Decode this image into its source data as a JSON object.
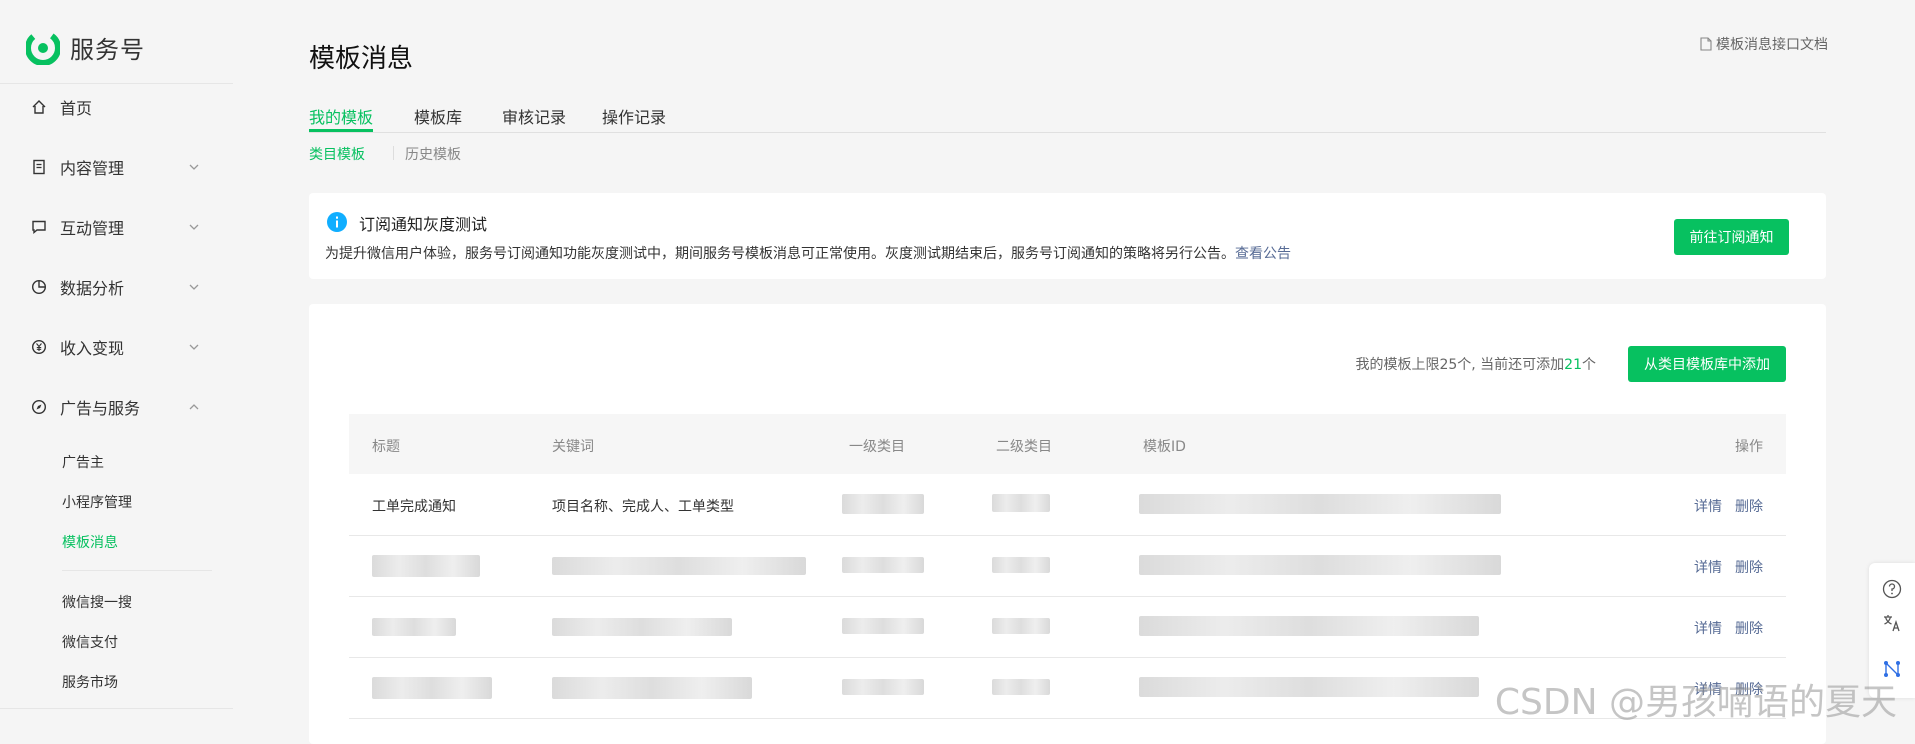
{
  "app": {
    "name": "服务号"
  },
  "sidebar": {
    "items": [
      {
        "label": "首页",
        "icon": "home-icon"
      },
      {
        "label": "内容管理",
        "icon": "document-icon",
        "expanded": false
      },
      {
        "label": "互动管理",
        "icon": "chat-icon",
        "expanded": false
      },
      {
        "label": "数据分析",
        "icon": "pie-chart-icon",
        "expanded": false
      },
      {
        "label": "收入变现",
        "icon": "yen-coin-icon",
        "expanded": false
      },
      {
        "label": "广告与服务",
        "icon": "compass-icon",
        "expanded": true
      }
    ],
    "sub_items": [
      {
        "label": "广告主",
        "active": false
      },
      {
        "label": "小程序管理",
        "active": false
      },
      {
        "label": "模板消息",
        "active": true
      },
      {
        "label": "微信搜一搜",
        "active": false
      },
      {
        "label": "微信支付",
        "active": false
      },
      {
        "label": "服务市场",
        "active": false
      }
    ]
  },
  "page": {
    "title": "模板消息",
    "doc_link": "模板消息接口文档",
    "tabs": [
      {
        "label": "我的模板",
        "active": true
      },
      {
        "label": "模板库",
        "active": false
      },
      {
        "label": "审核记录",
        "active": false
      },
      {
        "label": "操作记录",
        "active": false
      }
    ],
    "subtabs": [
      {
        "label": "类目模板",
        "active": true
      },
      {
        "label": "历史模板",
        "active": false
      }
    ]
  },
  "notice": {
    "title": "订阅通知灰度测试",
    "text": "为提升微信用户体验，服务号订阅通知功能灰度测试中，期间服务号模板消息可正常使用。灰度测试期结束后，服务号订阅通知的策略将另行公告。",
    "link": "查看公告",
    "button": "前往订阅通知"
  },
  "panel": {
    "limit_prefix": "我的模板上限25个, 当前还可添加",
    "limit_num": "21",
    "limit_suffix": "个",
    "add_button": "从类目模板库中添加"
  },
  "table": {
    "headers": [
      "标题",
      "关键词",
      "一级类目",
      "二级类目",
      "模板ID",
      "操作"
    ],
    "rows": [
      {
        "title": "工单完成通知",
        "keywords": "项目名称、完成人、工单类型",
        "detail": "详情",
        "delete": "删除"
      },
      {
        "title": "",
        "keywords": "",
        "detail": "详情",
        "delete": "删除"
      },
      {
        "title": "",
        "keywords": "",
        "detail": "详情",
        "delete": "删除"
      },
      {
        "title": "",
        "keywords": "",
        "detail": "详情",
        "delete": "删除"
      }
    ]
  },
  "watermark": "CSDN @男孩喃语的夏天",
  "colors": {
    "accent": "#07c160",
    "link": "#576b95",
    "info": "#10aeff"
  }
}
